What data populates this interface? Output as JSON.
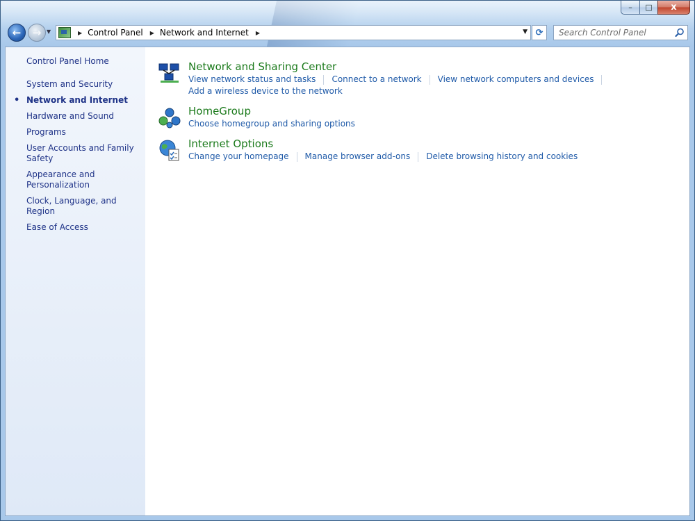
{
  "window": {
    "caption_min": "–",
    "caption_max": "□",
    "caption_close": "x"
  },
  "nav": {
    "back_glyph": "←",
    "forward_glyph": "→"
  },
  "address": {
    "crumbs": [
      "Control Panel",
      "Network and Internet"
    ],
    "refresh_glyph": "⟳"
  },
  "search": {
    "placeholder": "Search Control Panel"
  },
  "sidebar": {
    "home": "Control Panel Home",
    "items": [
      {
        "label": "System and Security",
        "active": false
      },
      {
        "label": "Network and Internet",
        "active": true
      },
      {
        "label": "Hardware and Sound",
        "active": false
      },
      {
        "label": "Programs",
        "active": false
      },
      {
        "label": "User Accounts and Family Safety",
        "active": false
      },
      {
        "label": "Appearance and Personalization",
        "active": false
      },
      {
        "label": "Clock, Language, and Region",
        "active": false
      },
      {
        "label": "Ease of Access",
        "active": false
      }
    ]
  },
  "categories": [
    {
      "title": "Network and Sharing Center",
      "icon": "network-sharing-icon",
      "links": [
        "View network status and tasks",
        "Connect to a network",
        "View network computers and devices",
        "Add a wireless device to the network"
      ]
    },
    {
      "title": "HomeGroup",
      "icon": "homegroup-icon",
      "links": [
        "Choose homegroup and sharing options"
      ]
    },
    {
      "title": "Internet Options",
      "icon": "internet-options-icon",
      "links": [
        "Change your homepage",
        "Manage browser add-ons",
        "Delete browsing history and cookies"
      ]
    }
  ],
  "colors": {
    "link": "#1f5aa8",
    "category_title": "#1b7a1b",
    "sidebar_text": "#1e3287"
  }
}
